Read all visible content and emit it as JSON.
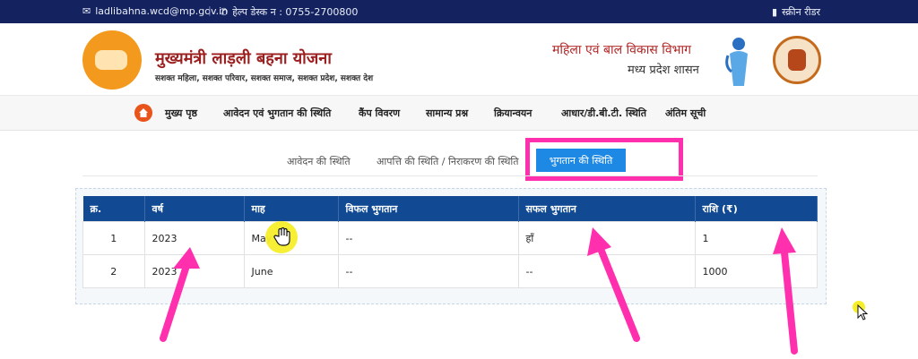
{
  "topbar": {
    "email": "ladlibahna.wcd@mp.gov.in",
    "helpdesk": "हेल्प डेस्क न : 0755-2700800",
    "screen_reader": "स्क्रीन रीडर"
  },
  "header": {
    "title": "मुख्यमंत्री लाड़ली बहना योजना",
    "tagline": "सशक्त महिला, सशक्त परिवार, सशक्त समाज, सशक्त प्रदेश, सशक्त देश",
    "department": "महिला एवं बाल विकास विभाग",
    "government": "मध्य प्रदेश शासन"
  },
  "nav": {
    "items": [
      {
        "label": "मुख्य पृष्ठ"
      },
      {
        "label": "आवेदन एवं भुगतान की स्थिति"
      },
      {
        "label": "कैंप विवरण"
      },
      {
        "label": "सामान्य प्रश्न"
      },
      {
        "label": "क्रियान्वयन"
      },
      {
        "label": "आधार/डी.बी.टी. स्थिति"
      },
      {
        "label": "अंतिम सूची"
      }
    ]
  },
  "tabs": {
    "items": [
      {
        "label": "आवेदन की स्थिति"
      },
      {
        "label": "आपत्ति की स्थिति / निराकरण की स्थिति"
      },
      {
        "label": "भुगतान की स्थिति"
      }
    ],
    "active": "भुगतान की स्थिति"
  },
  "table": {
    "headers": [
      "क्र.",
      "वर्ष",
      "माह",
      "विफल भुगतान",
      "सफल भुगतान",
      "राशि (₹)"
    ],
    "rows": [
      [
        "1",
        "2023",
        "May",
        "--",
        "हाँ",
        "1"
      ],
      [
        "2",
        "2023",
        "June",
        "--",
        "--",
        "1000"
      ]
    ]
  },
  "colors": {
    "topbar": "#14235f",
    "table_header": "#114a92",
    "active_tab": "#1e88e5",
    "highlight": "#ff2fae"
  }
}
